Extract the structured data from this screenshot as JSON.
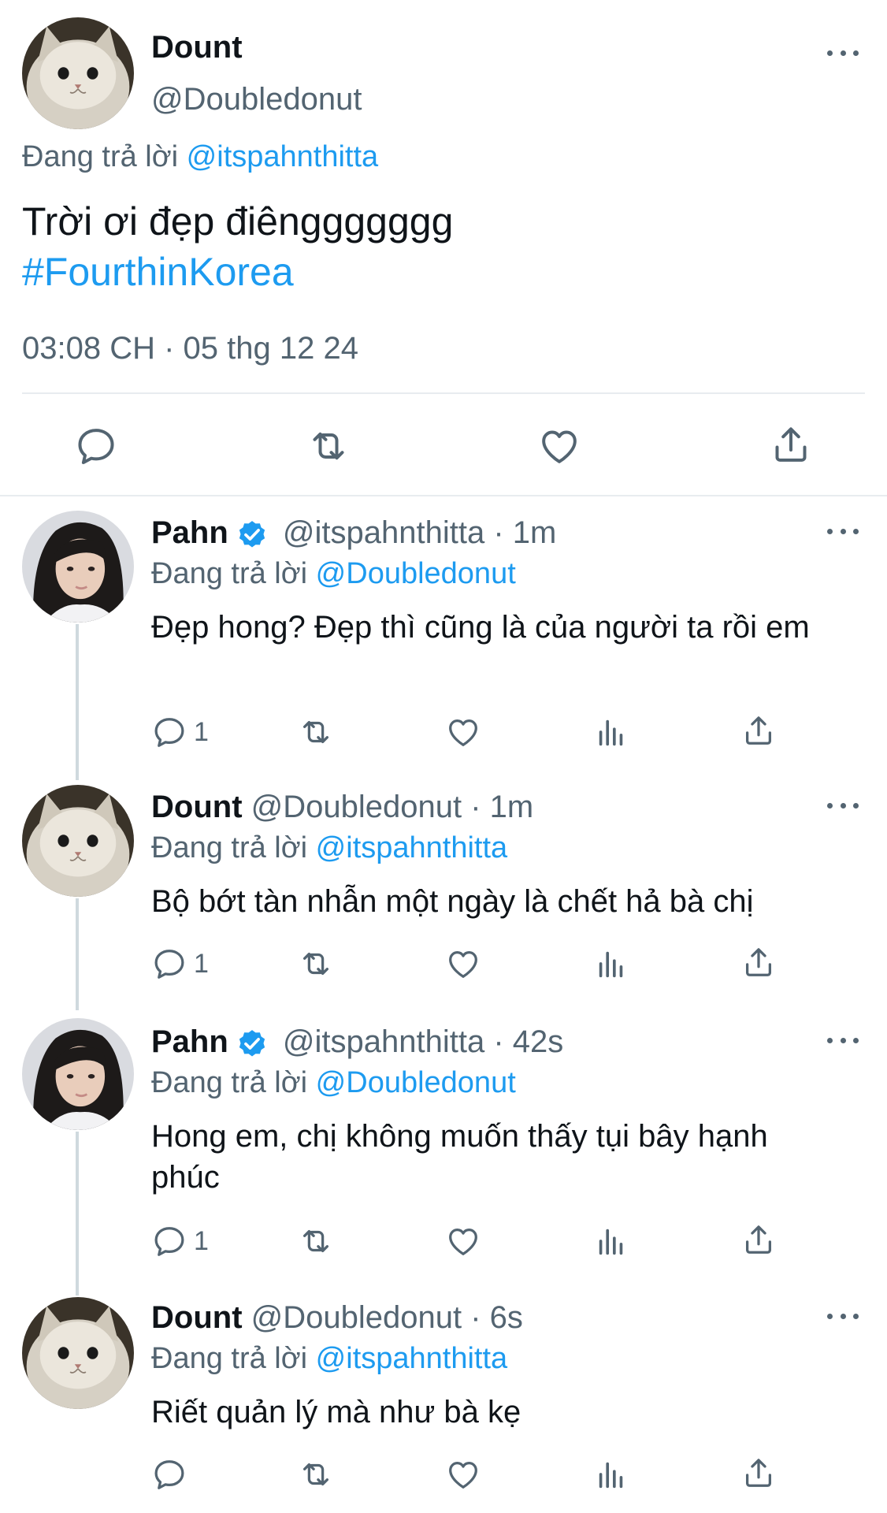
{
  "main_tweet": {
    "author_name": "Dount",
    "author_handle": "@Doubledonut",
    "replying_prefix": "Đang trả lời",
    "replying_handle": "@itspahnthitta",
    "text_line1": "Trời ơi đẹp điênggggggg",
    "hashtag": "#FourthinKorea",
    "timestamp": "03:08 CH · 05 thg 12 24"
  },
  "replies": [
    {
      "name": "Pahn",
      "verified": true,
      "handle_time": "@itspahnthitta · 1m",
      "replying_prefix": "Đang trả lời",
      "replying_handle": "@Doubledonut",
      "text": "Đẹp hong? Đẹp thì cũng là của người ta rồi em",
      "reply_count": "1"
    },
    {
      "name": "Dount",
      "verified": false,
      "handle_time": "@Doubledonut · 1m",
      "replying_prefix": "Đang trả lời",
      "replying_handle": "@itspahnthitta",
      "text": "Bộ bớt tàn nhẫn một ngày là chết hả bà chị",
      "reply_count": "1"
    },
    {
      "name": "Pahn",
      "verified": true,
      "handle_time": "@itspahnthitta · 42s",
      "replying_prefix": "Đang trả lời",
      "replying_handle": "@Doubledonut",
      "text": "Hong em, chị không muốn thấy tụi bây hạnh phúc",
      "reply_count": "1"
    },
    {
      "name": "Dount",
      "verified": false,
      "handle_time": "@Doubledonut · 6s",
      "replying_prefix": "Đang trả lời",
      "replying_handle": "@itspahnthitta",
      "text": "Riết quản lý mà như bà kẹ",
      "reply_count": ""
    }
  ],
  "icons": {
    "reply": "reply-icon",
    "retweet": "retweet-icon",
    "like": "like-icon",
    "share": "share-icon",
    "views": "views-icon",
    "more": "more-icon",
    "verified": "verified-badge-icon"
  },
  "colors": {
    "accent": "#1d9bf0",
    "text": "#0f1419",
    "secondary": "#536471",
    "divider": "#e8ecef"
  }
}
